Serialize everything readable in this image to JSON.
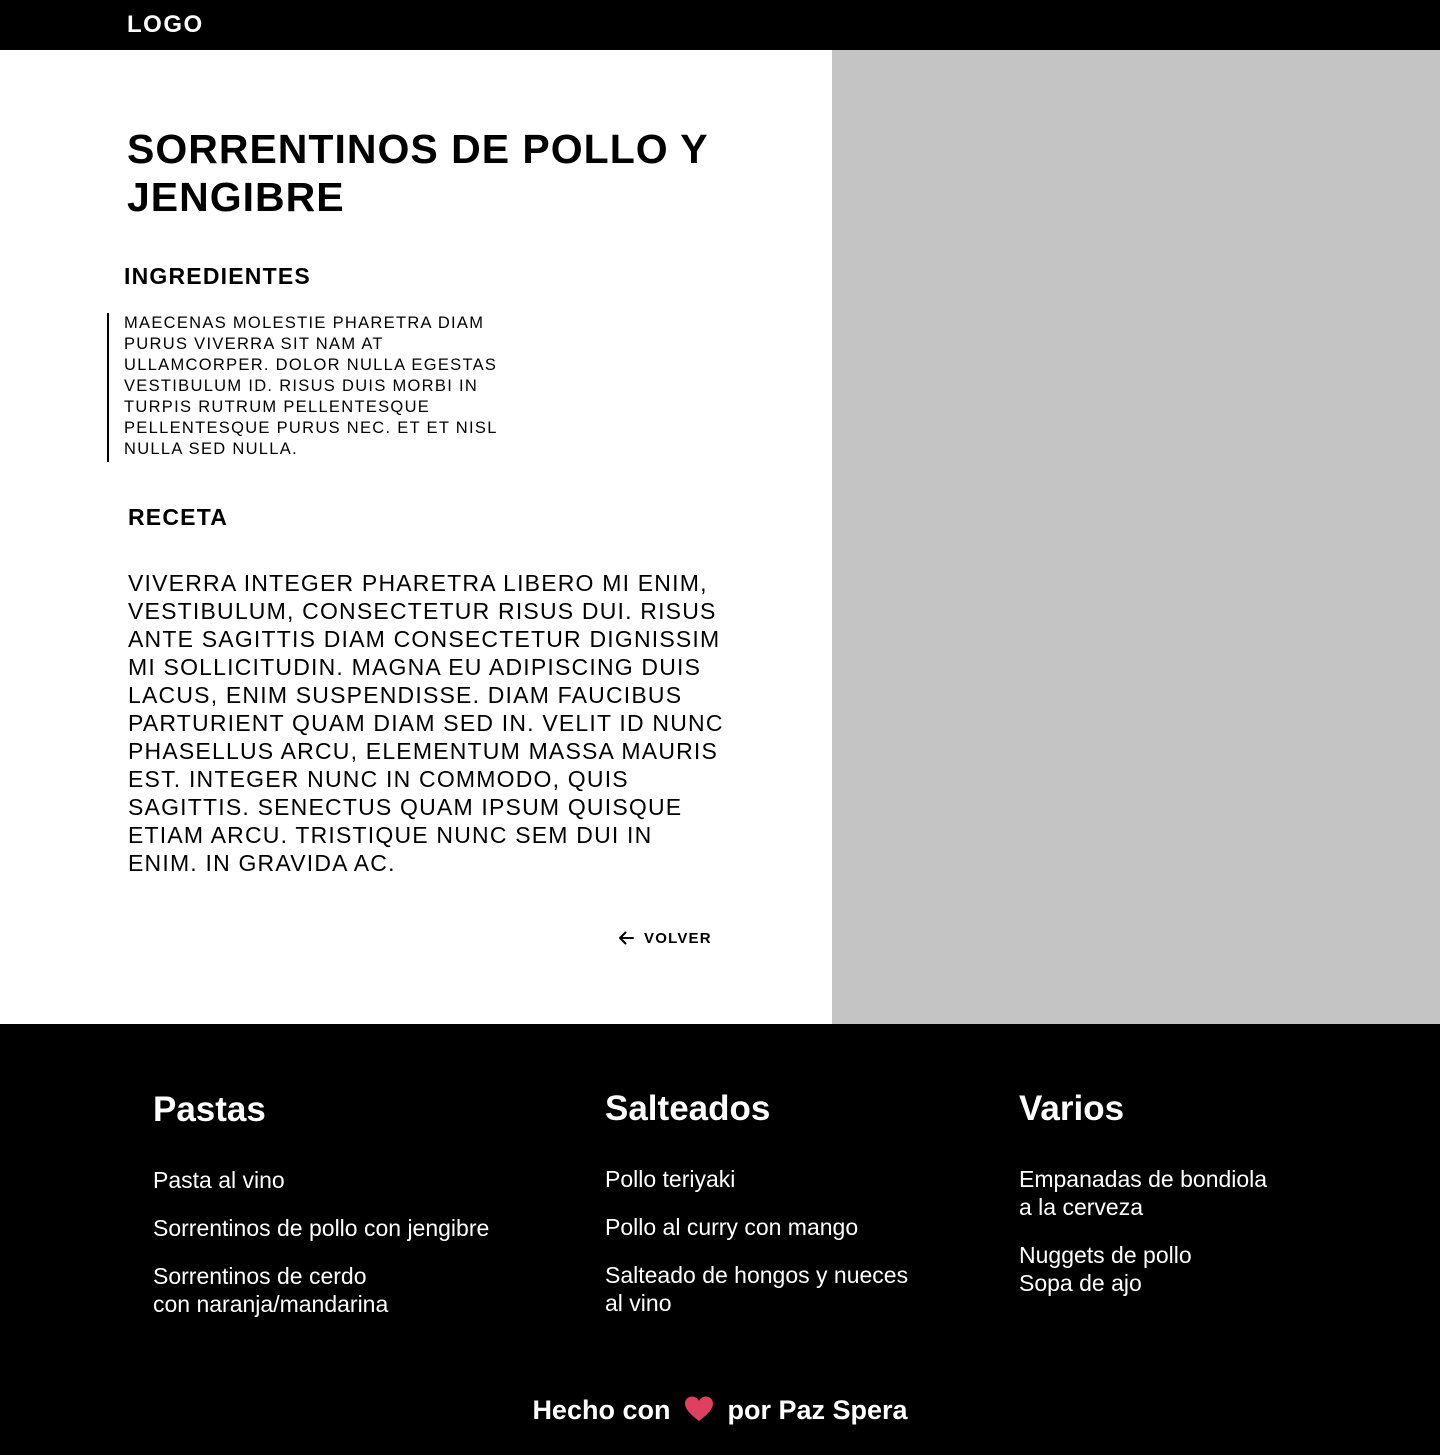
{
  "header": {
    "logo": "LOGO"
  },
  "recipe": {
    "title": "SORRENTINOS DE POLLO Y JENGIBRE",
    "ingredients_heading": "INGREDIENTES",
    "ingredients_text": "Maecenas molestie pharetra diam purus viverra sit nam at ullamcorper. Dolor nulla egestas vestibulum id. Risus duis morbi in turpis rutrum pellentesque pellentesque purus nec. Et et nisl nulla sed nulla.",
    "recipe_heading": "RECETA",
    "recipe_text": "Viverra integer pharetra libero mi enim, vestibulum, consectetur risus dui. Risus ante sagittis diam consectetur dignissim mi sollicitudin. Magna eu adipiscing duis lacus, enim suspendisse. Diam faucibus parturient quam diam sed in. Velit id nunc phasellus arcu, elementum massa mauris est. Integer nunc in commodo, quis sagittis. Senectus quam ipsum quisque etiam arcu. Tristique nunc sem dui in enim. In gravida ac.",
    "back_label": "VOLVER",
    "back_icon": "arrow-left-icon"
  },
  "footer": {
    "pastas": {
      "title": "Pastas",
      "items": [
        "Pasta al vino",
        "Sorrentinos de pollo con jengibre",
        "Sorrentinos de cerdo\ncon naranja/mandarina"
      ]
    },
    "salteados": {
      "title": "Salteados",
      "items": [
        "Pollo teriyaki",
        "Pollo al curry con mango",
        "Salteado de hongos y nueces\nal vino"
      ]
    },
    "varios": {
      "title": "Varios",
      "items": [
        "Empanadas de bondiola\na la cerveza",
        "Nuggets de pollo\nSopa de ajo"
      ]
    },
    "credit_prefix": "Hecho con",
    "credit_suffix": "por Paz Spera",
    "heart_icon": "heart-icon",
    "heart_color": "#e0405f"
  },
  "colors": {
    "image_placeholder": "#c4c4c4",
    "bar": "#000000"
  }
}
